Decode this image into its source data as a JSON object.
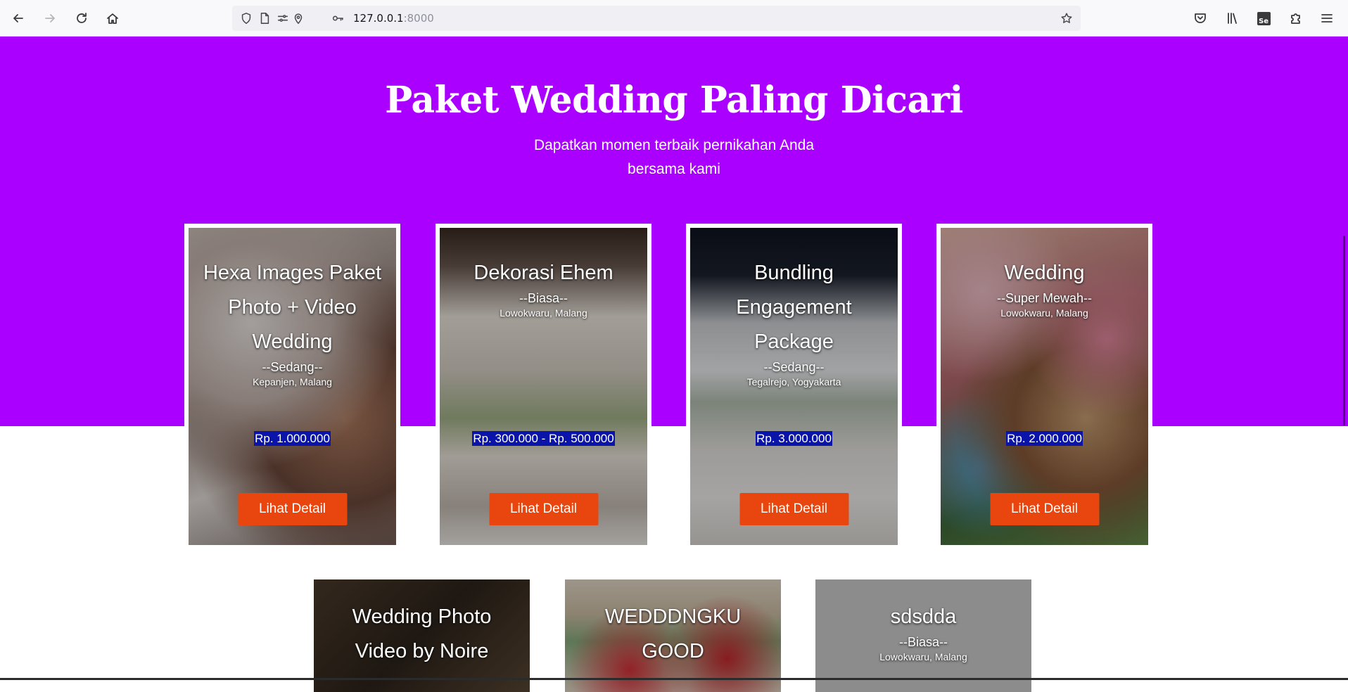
{
  "browser": {
    "url_host": "127.0.0.1",
    "url_port": ":8000"
  },
  "hero": {
    "title": "Paket Wedding Paling Dicari",
    "subtitle": "Dapatkan momen terbaik pernikahan Anda bersama kami"
  },
  "colors": {
    "hero_bg": "#aa00ff",
    "button": "#e8460e",
    "price_highlight": "#0a14a8"
  },
  "packages": [
    {
      "title": "Hexa Images Paket Photo + Video Wedding",
      "level": "--Sedang--",
      "location": "Kepanjen, Malang",
      "price": "Rp. 1.000.000",
      "button": "Lihat Detail"
    },
    {
      "title": "Dekorasi Ehem",
      "level": "--Biasa--",
      "location": "Lowokwaru, Malang",
      "price": "Rp. 300.000 - Rp. 500.000",
      "button": "Lihat Detail"
    },
    {
      "title": "Bundling Engagement Package",
      "level": "--Sedang--",
      "location": "Tegalrejo, Yogyakarta",
      "price": "Rp. 3.000.000",
      "button": "Lihat Detail"
    },
    {
      "title": "Wedding",
      "level": "--Super Mewah--",
      "location": "Lowokwaru, Malang",
      "price": "Rp. 2.000.000",
      "button": "Lihat Detail"
    },
    {
      "title": "Wedding Photo Video by Noire"
    },
    {
      "title": "WEDDDNGKU GOOD"
    },
    {
      "title": "sdsdda",
      "level": "--Biasa--",
      "location": "Lowokwaru, Malang"
    }
  ]
}
